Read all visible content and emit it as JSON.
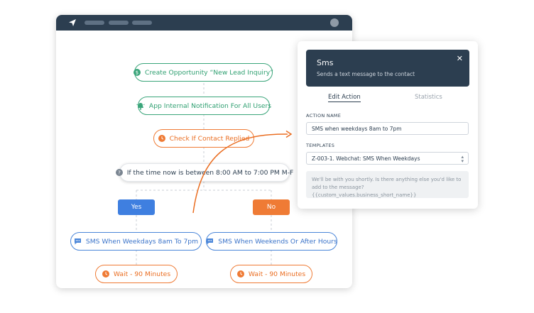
{
  "flow": {
    "nodes": {
      "create_opportunity": "Create Opportunity “New Lead Inquiry”",
      "app_notification": "App Internal Notification For All Users",
      "check_reply": "Check If Contact Replied",
      "condition": "If the time now is between 8:00 AM to 7:00 PM M-F",
      "yes": "Yes",
      "no": "No",
      "sms_weekdays": "SMS When Weekdays 8am To 7pm",
      "sms_weekends": "SMS When Weekends Or After Hours",
      "wait_left": "Wait - 90 Minutes",
      "wait_right": "Wait - 90 Minutes"
    },
    "icons": {
      "create_opportunity": "dollar-icon",
      "app_notification": "bell-icon",
      "check_reply": "clock-icon",
      "condition": "question-icon",
      "sms": "chat-icon",
      "wait": "clock-icon"
    },
    "colors": {
      "green": "#3aa57a",
      "orange": "#ef7b35",
      "blue": "#4a86d9",
      "dark": "#2c3e50"
    }
  },
  "panel": {
    "title": "Sms",
    "subtitle": "Sends a text message to the contact",
    "tabs": {
      "edit": "Edit Action",
      "stats": "Statistics"
    },
    "action_name_label": "ACTION NAME",
    "action_name_value": "SMS when weekdays 8am to 7pm",
    "templates_label": "TEMPLATES",
    "template_value": "Z-003-1. Webchat: SMS When Weekdays",
    "message": "We'll be with you shortly. Is there anything else you'd like to add to the message?{{custom_values.business_short_name}}"
  }
}
